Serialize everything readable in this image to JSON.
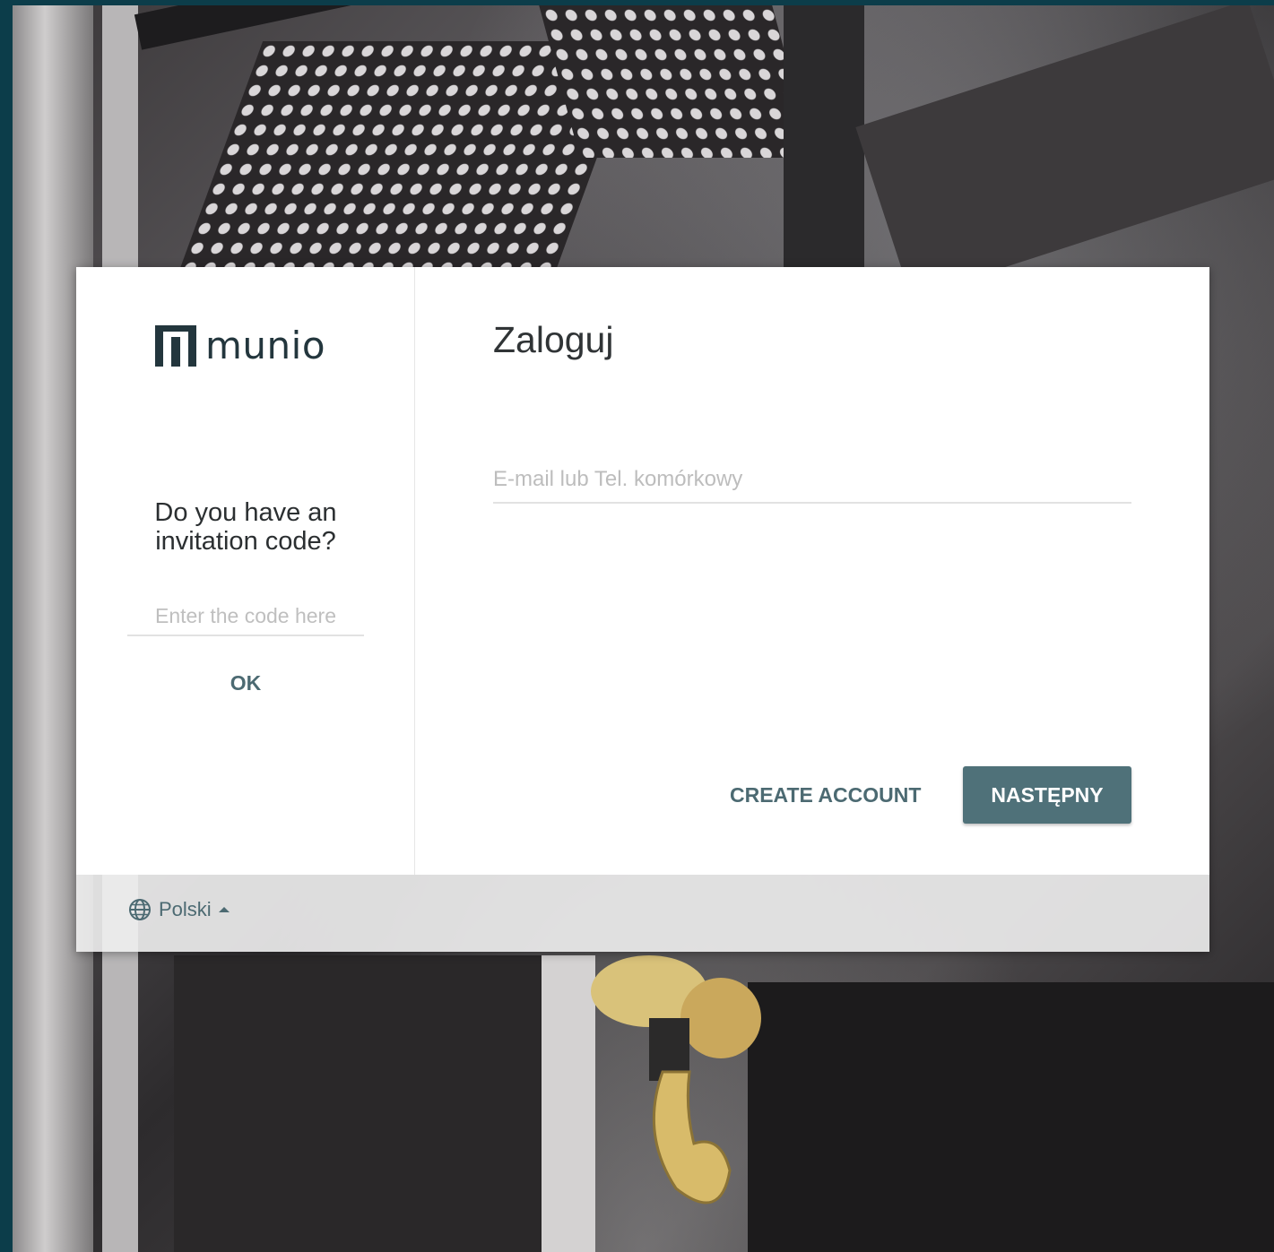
{
  "brand": {
    "name": "munio",
    "accent": "#4f7179",
    "text_accent": "#4c6a72"
  },
  "invite": {
    "title_line1": "Do you have an",
    "title_line2": "invitation code?",
    "placeholder": "Enter the code here",
    "value": "",
    "ok_label": "OK"
  },
  "login": {
    "title": "Zaloguj",
    "email_placeholder": "E-mail lub Tel. komórkowy",
    "email_value": "",
    "create_account_label": "CREATE ACCOUNT",
    "next_label": "NASTĘPNY"
  },
  "footer": {
    "language": "Polski",
    "language_icon": "globe-icon",
    "language_caret": "caret-up-icon"
  }
}
